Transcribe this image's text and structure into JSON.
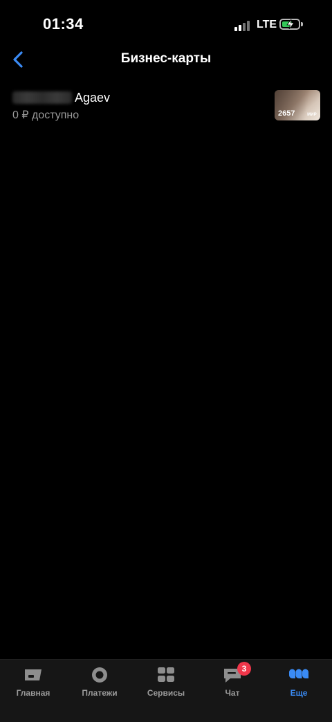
{
  "status_bar": {
    "time": "01:34",
    "network": "LTE",
    "battery_level": 0.55,
    "battery_color": "#34c759"
  },
  "header": {
    "title": "Бизнес-карты",
    "back_icon": "chevron-left-icon",
    "accent_color": "#3a8bf5"
  },
  "cards": [
    {
      "owner_name": "Agaev",
      "balance": "0 ₽ доступно",
      "last4": "2657",
      "brand": "МИР"
    }
  ],
  "tab_bar": {
    "active_color": "#3a8bf5",
    "tabs": [
      {
        "label": "Главная",
        "icon": "home-card-icon",
        "active": false
      },
      {
        "label": "Платежи",
        "icon": "payments-circle-icon",
        "active": false
      },
      {
        "label": "Сервисы",
        "icon": "services-grid-icon",
        "active": false
      },
      {
        "label": "Чат",
        "icon": "chat-bubble-icon",
        "active": false,
        "badge": "3"
      },
      {
        "label": "Еще",
        "icon": "more-dots-icon",
        "active": true
      }
    ]
  }
}
